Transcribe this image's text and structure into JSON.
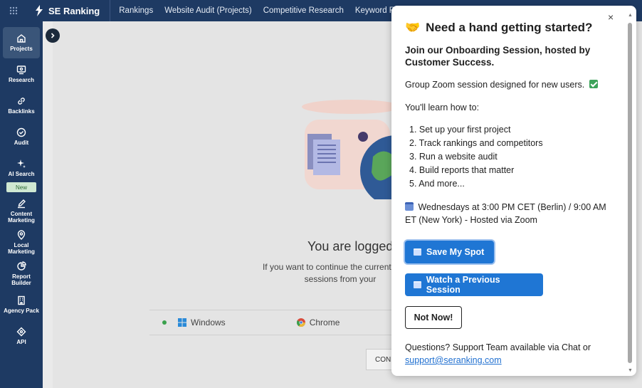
{
  "topbar": {
    "brand": "SE Ranking",
    "nav": [
      "Rankings",
      "Website Audit (Projects)",
      "Competitive Research",
      "Keyword Rese"
    ]
  },
  "sidebar": {
    "items": [
      {
        "label": "Projects",
        "icon": "home-icon",
        "active": true
      },
      {
        "label": "Research",
        "icon": "research-icon"
      },
      {
        "label": "Backlinks",
        "icon": "link-icon"
      },
      {
        "label": "Audit",
        "icon": "check-circle-icon"
      },
      {
        "label": "AI Search",
        "icon": "sparkle-icon"
      },
      {
        "label": "Content Marketing",
        "icon": "edit-icon"
      },
      {
        "label": "Local Marketing",
        "icon": "location-pin-icon"
      },
      {
        "label": "Report Builder",
        "icon": "pie-chart-icon"
      },
      {
        "label": "Agency Pack",
        "icon": "building-icon"
      },
      {
        "label": "API",
        "icon": "api-icon"
      }
    ],
    "new_badge": "New"
  },
  "main": {
    "title": "You are logged",
    "text_line1": "If you want to continue the current sessio",
    "text_line2": "sessions from your",
    "os": "Windows",
    "browser": "Chrome",
    "continue_label": "CON"
  },
  "popup": {
    "title_emoji": "🤝",
    "title": "Need a hand getting started?",
    "subtitle": "Join our Onboarding Session, hosted by Customer Success.",
    "intro": "Group Zoom session designed for new users.",
    "learn_label": "You'll learn how to:",
    "steps": [
      "1. Set up your first project",
      "2. Track rankings and competitors",
      "3. Run a website audit",
      "4. Build reports that matter",
      "5. And more..."
    ],
    "schedule": "Wednesdays at 3:00 PM CET (Berlin) / 9:00 AM ET (New York) - Hosted via Zoom",
    "save_button": "Save My Spot",
    "watch_button": "Watch a Previous Session",
    "not_now_button": "Not Now!",
    "questions_text": "Questions? Support Team available via Chat or",
    "support_email": "support@seranking.com",
    "close": "×"
  },
  "colors": {
    "nav_bg": "#1e3a63",
    "primary_button": "#1f76d4",
    "link": "#1f6fd0"
  }
}
